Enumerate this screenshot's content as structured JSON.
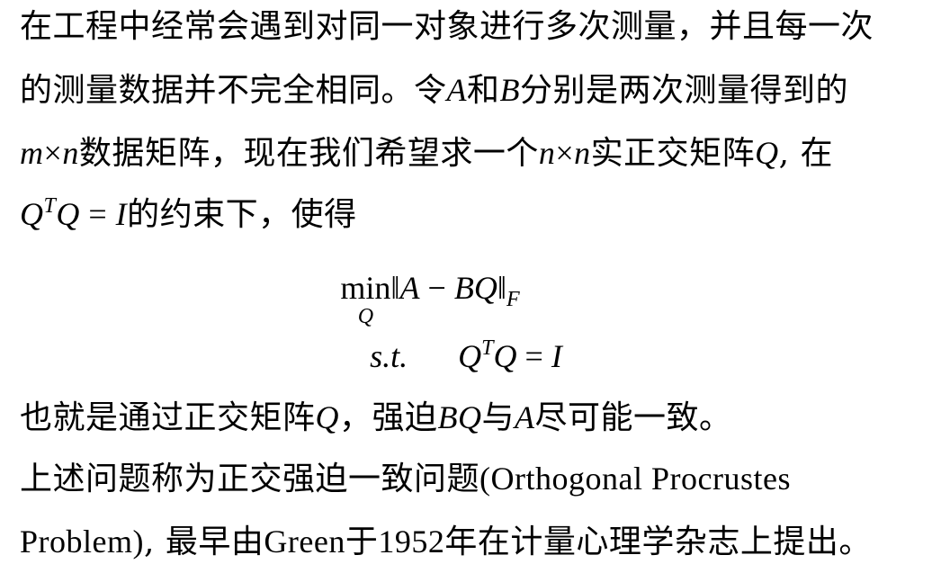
{
  "lines": {
    "l1": "在工程中经常会遇到对同一对象进行多次测量，并且每一次",
    "l2_a": "的测量数据并不完全相同。令",
    "l2_A": "A",
    "l2_b": "和",
    "l2_B": "B",
    "l2_c": "分别是两次测量得到的",
    "l3_m": "m",
    "l3_x1": "×",
    "l3_n1": "n",
    "l3_a": "数据矩阵，现在我们希望求一个",
    "l3_n2": "n",
    "l3_x2": "×",
    "l3_n3": "n",
    "l3_b": "实正交矩阵",
    "l3_Q": "Q",
    "l3_c": ", 在",
    "l4_Q1": "Q",
    "l4_T": "T",
    "l4_Q2": "Q",
    "l4_eq": " = ",
    "l4_I": "I",
    "l4_a": "的约束下，使得"
  },
  "formula": {
    "min": "min",
    "min_sub": "Q",
    "norm_open": "‖",
    "A": "A",
    "minus": " − ",
    "BQ": "BQ",
    "norm_close": "‖",
    "norm_sub": "F",
    "st": "s.t.",
    "Q1": "Q",
    "T": "T",
    "Q2": "Q",
    "eq": " = ",
    "I": "I"
  },
  "after": {
    "l5_a": "也就是通过正交矩阵",
    "l5_Q": "Q",
    "l5_b": "，强迫",
    "l5_BQ": "BQ",
    "l5_c": "与",
    "l5_A": "A",
    "l5_d": "尽可能一致。",
    "l6_a": "上述问题称为正交强迫一致问题",
    "l6_b": "(Orthogonal Procrustes",
    "l7_a": "Problem)",
    "l7_b": ", 最早由",
    "l7_c": "Green",
    "l7_d": "于",
    "l7_e": "1952",
    "l7_f": "年在计量心理学杂志上提出。"
  }
}
